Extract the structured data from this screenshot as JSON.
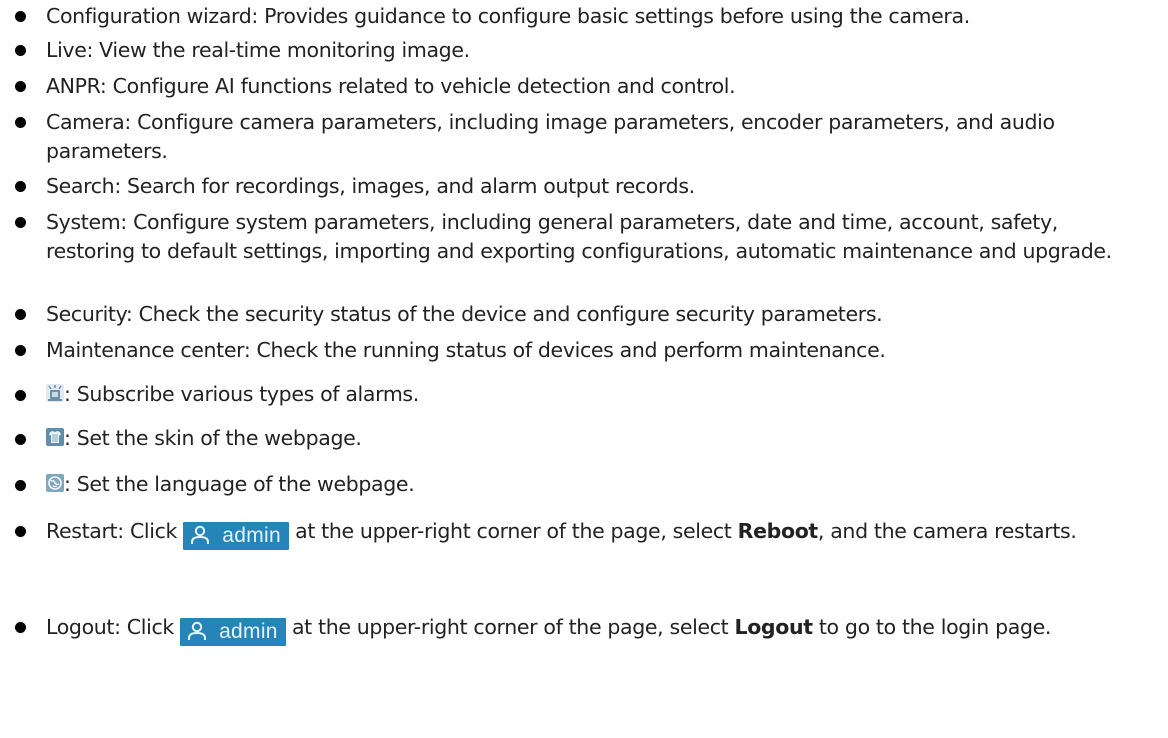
{
  "items": [
    {
      "text": "Configuration wizard: Provides guidance to configure basic settings before using the camera."
    },
    {
      "text": "Live: View the real-time monitoring image."
    },
    {
      "text": "ANPR: Configure AI functions related to vehicle detection and control."
    },
    {
      "text": "Camera: Configure camera parameters, including image parameters, encoder parameters, and audio parameters."
    },
    {
      "text": "Search: Search for recordings, images, and alarm output records."
    },
    {
      "text": "System: Configure system parameters, including general parameters, date and time, account, safety, restoring to default settings, importing and exporting configurations, automatic maintenance and upgrade."
    },
    {
      "text": "Security: Check the security status of the device and configure security parameters."
    },
    {
      "text": "Maintenance center: Check the running status of devices and perform maintenance."
    }
  ],
  "icon_items": [
    {
      "icon": "alarm-subscribe-icon",
      "text": ": Subscribe various types of alarms."
    },
    {
      "icon": "skin-icon",
      "text": ": Set the skin of the webpage."
    },
    {
      "icon": "language-icon",
      "text": ": Set the language of the webpage."
    }
  ],
  "restart": {
    "prefix": "Restart: Click ",
    "after_button": " at the upper-right corner of the page, select ",
    "bold": "Reboot",
    "suffix": ", and the camera restarts."
  },
  "logout": {
    "prefix": "Logout: Click ",
    "after_button": " at the upper-right corner of the page, select ",
    "bold": "Logout",
    "suffix": "  to go to the login page."
  },
  "admin_button": {
    "label": "admin",
    "icon": "user-icon",
    "bg": "#2585b8"
  }
}
